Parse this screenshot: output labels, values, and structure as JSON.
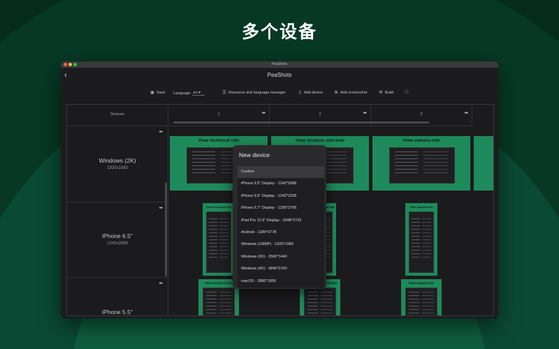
{
  "headline": "多个设备",
  "window": {
    "title": "PeaShots",
    "app_title": "PeaShots",
    "traffic_colors": [
      "#ff5f57",
      "#febc2e",
      "#28c840"
    ]
  },
  "toolbar": {
    "save": "Save",
    "language_label": "Language",
    "language_value": "en",
    "resources": "Resource and language manager",
    "add_device": "Add device",
    "add_screenshot": "Add screenshot",
    "build": "Build",
    "info_icon": "ⓘ"
  },
  "grid": {
    "devices_header": "Devices",
    "columns": [
      "1",
      "2",
      "3"
    ],
    "more": "•••",
    "devices": [
      {
        "name": "Windows (2K)",
        "resolution": "1920x1080"
      },
      {
        "name": "iPhone 6.5\"",
        "resolution": "1242x2688"
      },
      {
        "name": "iPhone 5.5\"",
        "resolution": ""
      }
    ],
    "shot_captions": {
      "technical": "View technical info",
      "location": "View location and date",
      "camera": "View camera info"
    }
  },
  "new_device_menu": {
    "title": "New device",
    "options": [
      "Custom",
      "iPhone 6.5\" Display - 1242*2688",
      "iPhone 5.5\" Display - 1242*2208",
      "iPhone 6.7\" Display - 1290*2796",
      "iPad Pro 12.9\" Display - 2048*2732",
      "Android - 1284*2778",
      "Windows (1080P) - 1920*1080",
      "Windows (2K) - 2560*1440",
      "Windows (4K) - 3840*2160",
      "macOS - 2880*1800"
    ],
    "selected": "Custom"
  },
  "colors": {
    "accent_green": "#1e8a5b",
    "background": "#052b1d",
    "window_bg": "#1c1c1e"
  }
}
